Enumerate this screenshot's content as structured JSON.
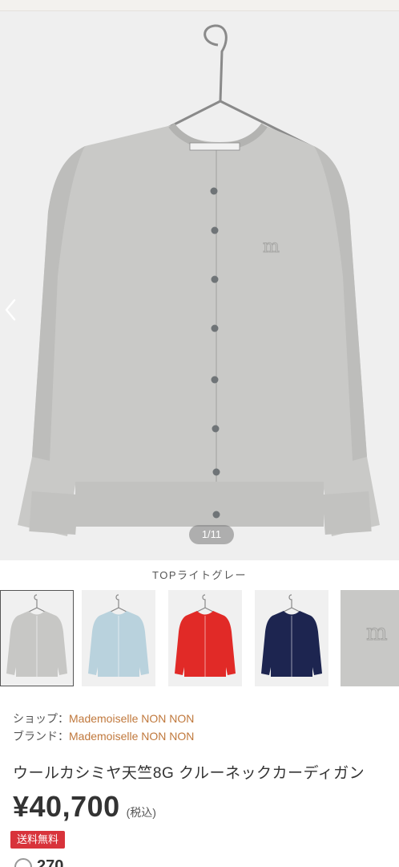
{
  "gallery": {
    "counter": "1/11",
    "prev_icon": "chevron-left-icon",
    "main_color": "#c9c9c7"
  },
  "color_label": "TOPライトグレー",
  "thumbnails": [
    {
      "name": "light-grey",
      "color": "#c7c7c5",
      "selected": true
    },
    {
      "name": "light-blue",
      "color": "#b9d2dd",
      "selected": false
    },
    {
      "name": "red",
      "color": "#e12a27",
      "selected": false
    },
    {
      "name": "navy",
      "color": "#1d2550",
      "selected": false
    },
    {
      "name": "detail",
      "color": "#c8c8c6",
      "selected": false
    }
  ],
  "shop": {
    "label": "ショップ：",
    "value": "Mademoiselle NON NON"
  },
  "brand": {
    "label": "ブランド：",
    "value": "Mademoiselle NON NON"
  },
  "product_title": "ウールカシミヤ天竺8G クルーネックカーディガン",
  "price": "¥40,700",
  "tax_note": "(税込)",
  "shipping_badge": "送料無料",
  "favorite_count": "270",
  "colors": {
    "accent_link": "#c0783c",
    "badge": "#d8333b"
  }
}
